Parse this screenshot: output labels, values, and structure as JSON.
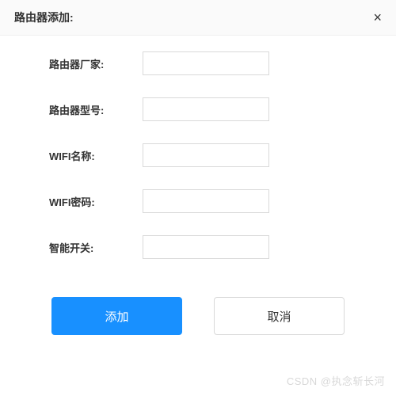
{
  "dialog": {
    "title": "路由器添加:",
    "close_icon": "×"
  },
  "form": {
    "fields": [
      {
        "label": "路由器厂家:",
        "value": ""
      },
      {
        "label": "路由器型号:",
        "value": ""
      },
      {
        "label": "WIFI名称:",
        "value": ""
      },
      {
        "label": "WIFI密码:",
        "value": ""
      },
      {
        "label": "智能开关:",
        "value": ""
      }
    ]
  },
  "buttons": {
    "submit": "添加",
    "cancel": "取消"
  },
  "watermark": "CSDN @执念斩长河"
}
